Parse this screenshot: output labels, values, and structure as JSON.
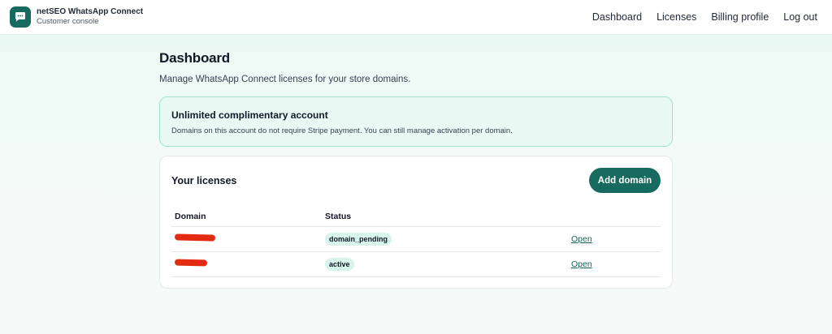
{
  "header": {
    "app_name": "netSEO WhatsApp Connect",
    "app_subtitle": "Customer console",
    "nav": [
      {
        "label": "Dashboard"
      },
      {
        "label": "Licenses"
      },
      {
        "label": "Billing profile"
      },
      {
        "label": "Log out"
      }
    ]
  },
  "page": {
    "title": "Dashboard",
    "description": "Manage WhatsApp Connect licenses for your store domains."
  },
  "notice": {
    "title": "Unlimited complimentary account",
    "body": "Domains on this account do not require Stripe payment. You can still manage activation per domain."
  },
  "licenses": {
    "title": "Your licenses",
    "add_button": "Add domain",
    "columns": [
      "Domain",
      "Status",
      ""
    ],
    "rows": [
      {
        "domain_redacted": true,
        "status": "domain_pending",
        "action": "Open"
      },
      {
        "domain_redacted": true,
        "status": "active",
        "action": "Open"
      }
    ]
  },
  "colors": {
    "brand": "#176b5e",
    "badge_bg": "#d7f5ea",
    "notice_bg": "#e9faf5",
    "notice_border": "#9fe3cd",
    "redaction": "#e32b12"
  },
  "icons": {
    "logo": "chat-bubble-icon"
  }
}
